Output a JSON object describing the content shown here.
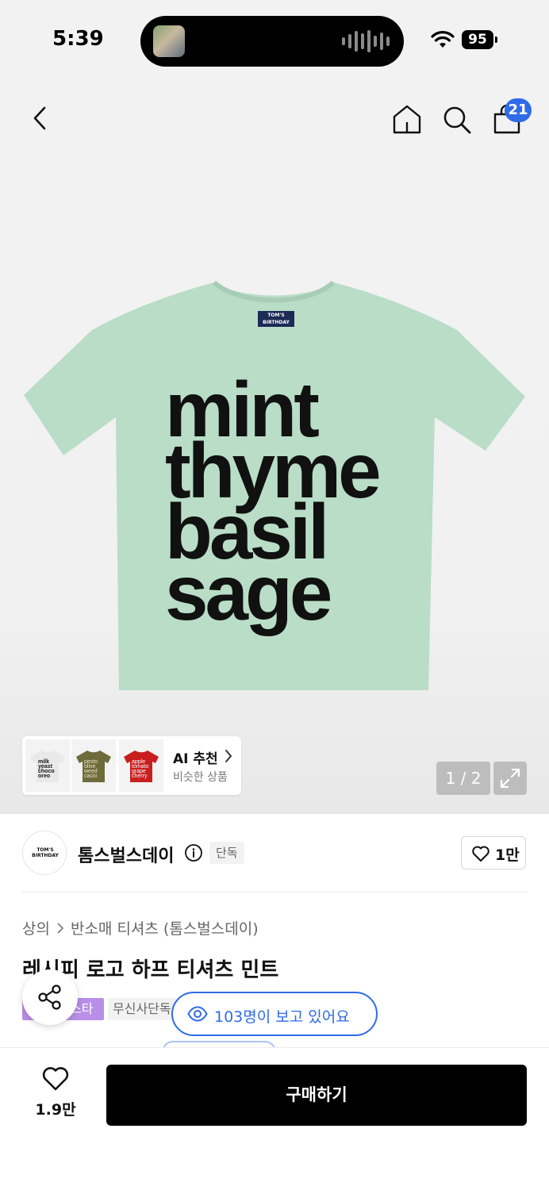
{
  "status_bar": {
    "time": "5:39",
    "battery": "95"
  },
  "nav": {
    "cart_badge": "21"
  },
  "hero": {
    "shirt_color": "#b9ddc7",
    "shirt_words": [
      "mint",
      "thyme",
      "basil",
      "sage"
    ],
    "shirt_tag": "TOM'S BIRTHDAY",
    "ai_recommend": {
      "title": "AI 추천",
      "subtitle": "비슷한 상품",
      "thumbs": [
        {
          "color": "#e9e9ea",
          "text_color": "#111111",
          "words": [
            "milk",
            "yeast",
            "choco",
            "oreo"
          ]
        },
        {
          "color": "#6f6a3a",
          "text_color": "#e9e3c8",
          "words": [
            "pesto",
            "olive",
            "weed",
            "cacio"
          ]
        },
        {
          "color": "#c81e1e",
          "text_color": "#ffffff",
          "words": [
            "apple",
            "tomato",
            "grape",
            "cherry"
          ]
        }
      ]
    },
    "page_counter": "1 / 2"
  },
  "brand": {
    "logo_text": "TOM'S BIRTHDAY",
    "name": "톰스벌스데이",
    "badge": "단독",
    "likes": "1만"
  },
  "product": {
    "breadcrumb": [
      "상의",
      "반소매 티셔츠 (톰스벌스데이)"
    ],
    "title": "레시피 로고 하프 티셔츠 민트",
    "tag_purple": "스타",
    "tag_gray": "무신사단독",
    "viewers": "103명이 보고 있어요"
  },
  "bottom": {
    "wish_count": "1.9만",
    "buy_label": "구매하기"
  }
}
